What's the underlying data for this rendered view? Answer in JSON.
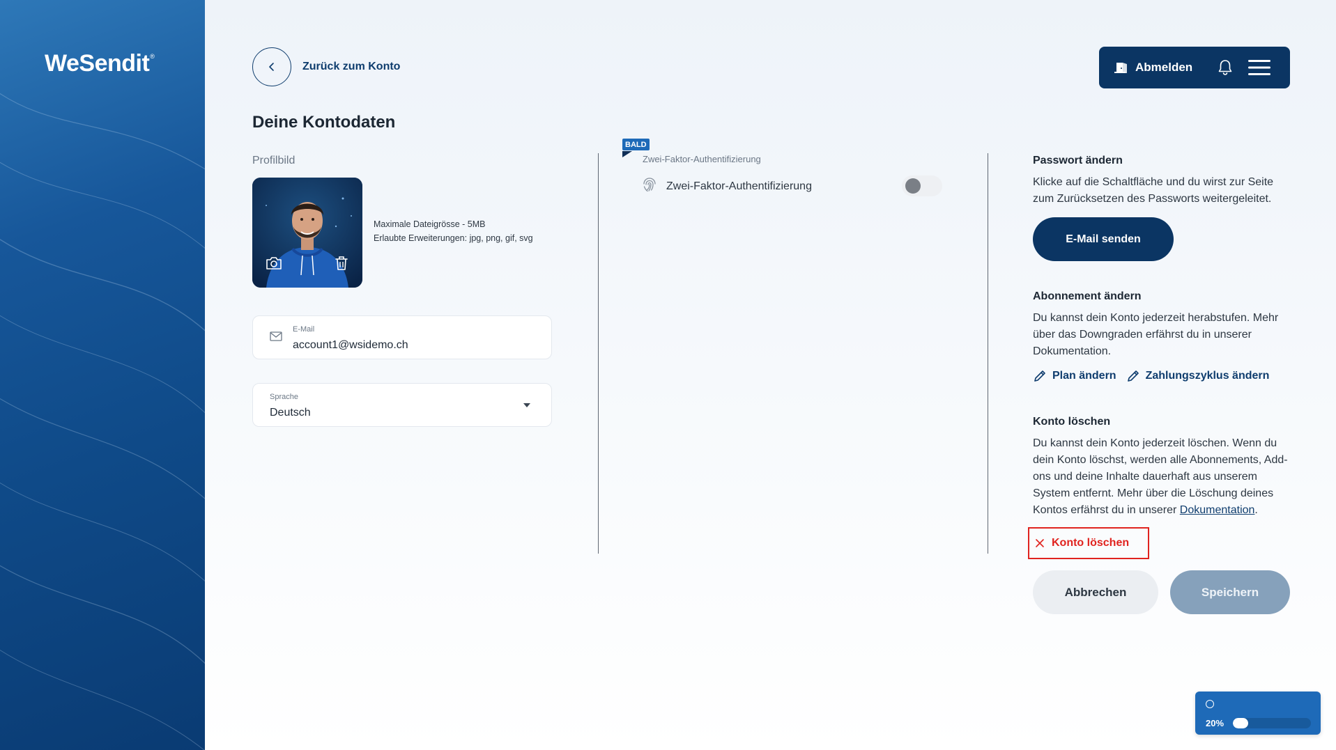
{
  "brand": {
    "logo_text": "WeSendit",
    "logo_mark": "®"
  },
  "nav": {
    "back_label": "Zurück zum Konto"
  },
  "topbar": {
    "logout_label": "Abmelden"
  },
  "page": {
    "title": "Deine Kontodaten"
  },
  "profile": {
    "label": "Profilbild",
    "max_size": "Maximale Dateigrösse - 5MB",
    "extensions": "Erlaubte Erweiterungen: jpg, png, gif, svg"
  },
  "email": {
    "label": "E-Mail",
    "value": "account1@wsidemo.ch"
  },
  "language": {
    "label": "Sprache",
    "value": "Deutsch"
  },
  "two_factor": {
    "badge": "BALD",
    "small_label": "Zwei-Faktor-Authentifizierung",
    "label": "Zwei-Faktor-Authentifizierung",
    "enabled": false
  },
  "password": {
    "title": "Passwort ändern",
    "text": "Klicke auf die Schaltfläche und du wirst zur Seite zum Zurücksetzen des Passworts weitergeleitet.",
    "button": "E-Mail senden"
  },
  "subscription": {
    "title": "Abonnement ändern",
    "text": "Du kannst dein Konto jederzeit herabstufen. Mehr über das Downgraden erfährst du in unserer Dokumentation.",
    "link_plan": "Plan ändern",
    "link_cycle": "Zahlungszyklus ändern"
  },
  "delete_account": {
    "title": "Konto löschen",
    "text": "Du kannst dein Konto jederzeit löschen. Wenn du dein Konto löschst, werden alle Abonnements, Add-ons und deine Inhalte dauerhaft aus unserem System entfernt. Mehr über die Löschung deines Kontos erfährst du in unserer",
    "link": "Dokumentation",
    "text_end": ".",
    "button": "Konto löschen"
  },
  "actions": {
    "cancel": "Abbrechen",
    "save": "Speichern"
  },
  "upload_progress": {
    "percent_label": "20%",
    "percent": 20
  },
  "colors": {
    "primary": "#0b3563",
    "accent": "#1e6ab8",
    "danger": "#e0231f",
    "save_disabled": "#86a1bb"
  }
}
